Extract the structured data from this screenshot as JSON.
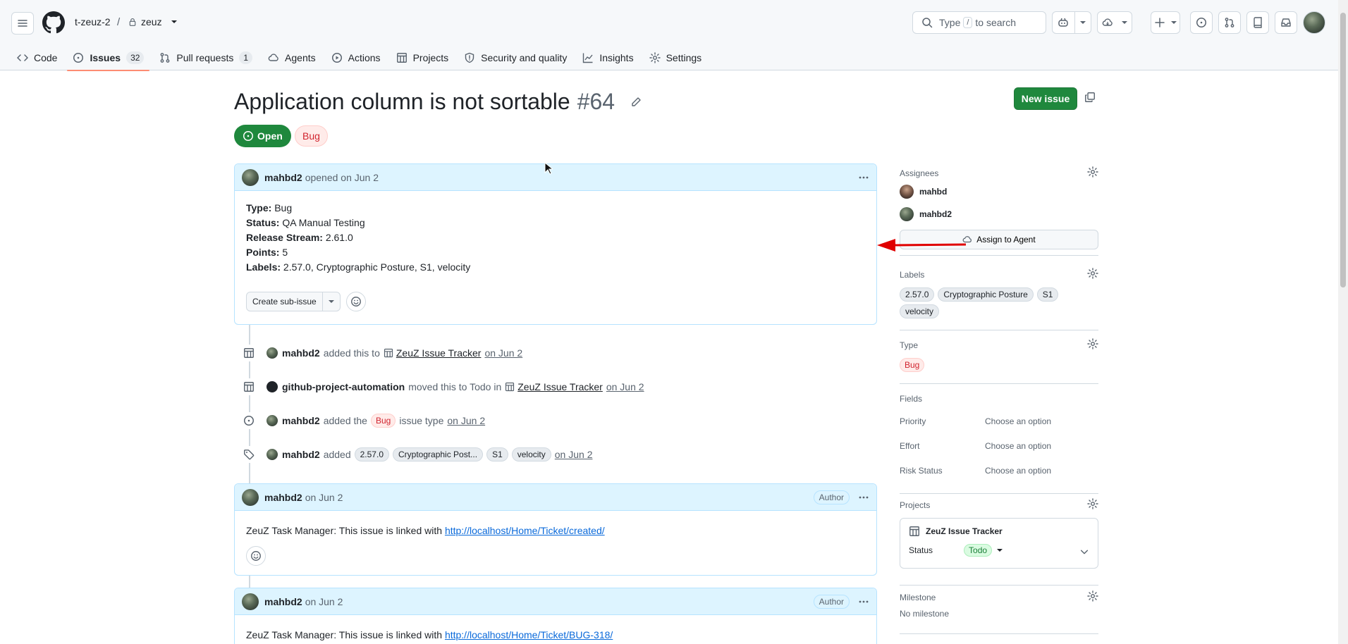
{
  "header": {
    "owner": "t-zeuz-2",
    "separator": "/",
    "repo": "zeuz",
    "search_placeholder_pre": "Type",
    "search_key": "/",
    "search_placeholder_post": "to search"
  },
  "nav": {
    "code": "Code",
    "issues": "Issues",
    "issues_count": "32",
    "pulls": "Pull requests",
    "pulls_count": "1",
    "agents": "Agents",
    "actions": "Actions",
    "projects": "Projects",
    "security": "Security and quality",
    "insights": "Insights",
    "settings": "Settings"
  },
  "issue": {
    "title": "Application column is not sortable",
    "number": "#64",
    "state": "Open",
    "type_label": "Bug",
    "new_issue": "New issue"
  },
  "body": {
    "author": "mahbd2",
    "opened": "opened on Jun 2",
    "fields": [
      {
        "key": "Type:",
        "value": "Bug"
      },
      {
        "key": "Status:",
        "value": "QA Manual Testing"
      },
      {
        "key": "Release Stream:",
        "value": "2.61.0"
      },
      {
        "key": "Points:",
        "value": "5"
      },
      {
        "key": "Labels:",
        "value": "2.57.0, Cryptographic Posture, S1, velocity"
      }
    ],
    "create_sub_issue": "Create sub-issue"
  },
  "timeline": {
    "e1": {
      "user": "mahbd2",
      "text": "added this to",
      "project": "ZeuZ Issue Tracker",
      "date": "on Jun 2"
    },
    "e2": {
      "user": "github-project-automation",
      "text": "moved this to Todo in",
      "project": "ZeuZ Issue Tracker",
      "date": "on Jun 2"
    },
    "e3": {
      "user": "mahbd2",
      "text_pre": "added the",
      "label": "Bug",
      "text_post": "issue type",
      "date": "on Jun 2"
    },
    "e4": {
      "user": "mahbd2",
      "text": "added",
      "labels": [
        "2.57.0",
        "Cryptographic Post...",
        "S1",
        "velocity"
      ],
      "date": "on Jun 2"
    }
  },
  "comments": [
    {
      "author": "mahbd2",
      "date": "on Jun 2",
      "badge": "Author",
      "text": "ZeuZ Task Manager: This issue is linked with",
      "link": "http://localhost/Home/Ticket/created/"
    },
    {
      "author": "mahbd2",
      "date": "on Jun 2",
      "badge": "Author",
      "text": "ZeuZ Task Manager: This issue is linked with",
      "link": "http://localhost/Home/Ticket/BUG-318/"
    }
  ],
  "sidebar": {
    "assignees_title": "Assignees",
    "assignees": [
      "mahbd",
      "mahbd2"
    ],
    "assign_agent": "Assign to Agent",
    "labels_title": "Labels",
    "labels": [
      "2.57.0",
      "Cryptographic Posture",
      "S1",
      "velocity"
    ],
    "type_title": "Type",
    "type_value": "Bug",
    "fields_title": "Fields",
    "fields": [
      {
        "name": "Priority",
        "value": "Choose an option"
      },
      {
        "name": "Effort",
        "value": "Choose an option"
      },
      {
        "name": "Risk Status",
        "value": "Choose an option"
      }
    ],
    "projects_title": "Projects",
    "project_name": "ZeuZ Issue Tracker",
    "project_status_label": "Status",
    "project_status": "Todo",
    "milestone_title": "Milestone",
    "milestone_value": "No milestone"
  },
  "colors": {
    "accent_green": "#1f883d",
    "link_blue": "#0969da",
    "bug_red": "#d1242f",
    "annotation_arrow": "#e00000"
  }
}
